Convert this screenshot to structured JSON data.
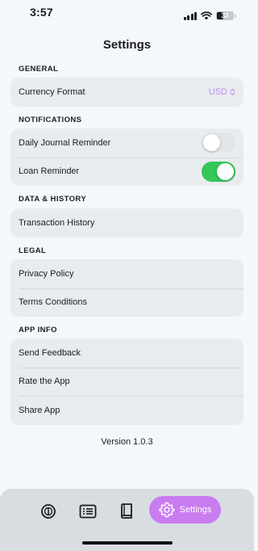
{
  "status": {
    "time": "3:57",
    "battery": "33"
  },
  "title": "Settings",
  "sections": {
    "general": {
      "header": "GENERAL",
      "currency_label": "Currency Format",
      "currency_value": "USD"
    },
    "notifications": {
      "header": "NOTIFICATIONS",
      "daily_label": "Daily Journal Reminder",
      "daily_on": false,
      "loan_label": "Loan Reminder",
      "loan_on": true
    },
    "data_history": {
      "header": "DATA & HISTORY",
      "transaction_label": "Transaction History"
    },
    "legal": {
      "header": "LEGAL",
      "privacy_label": "Privacy Policy",
      "terms_label": "Terms Conditions"
    },
    "app_info": {
      "header": "APP INFO",
      "feedback_label": "Send Feedback",
      "rate_label": "Rate the App",
      "share_label": "Share App"
    }
  },
  "version": "Version 1.0.3",
  "tabs": {
    "items": [
      {
        "icon": "info-icon"
      },
      {
        "icon": "list-icon"
      },
      {
        "icon": "book-icon"
      },
      {
        "icon": "gear-icon",
        "label": "Settings",
        "active": true
      }
    ]
  },
  "colors": {
    "accent": "#c97cf0",
    "toggle_on": "#34c759",
    "background": "#f4f8fc"
  }
}
